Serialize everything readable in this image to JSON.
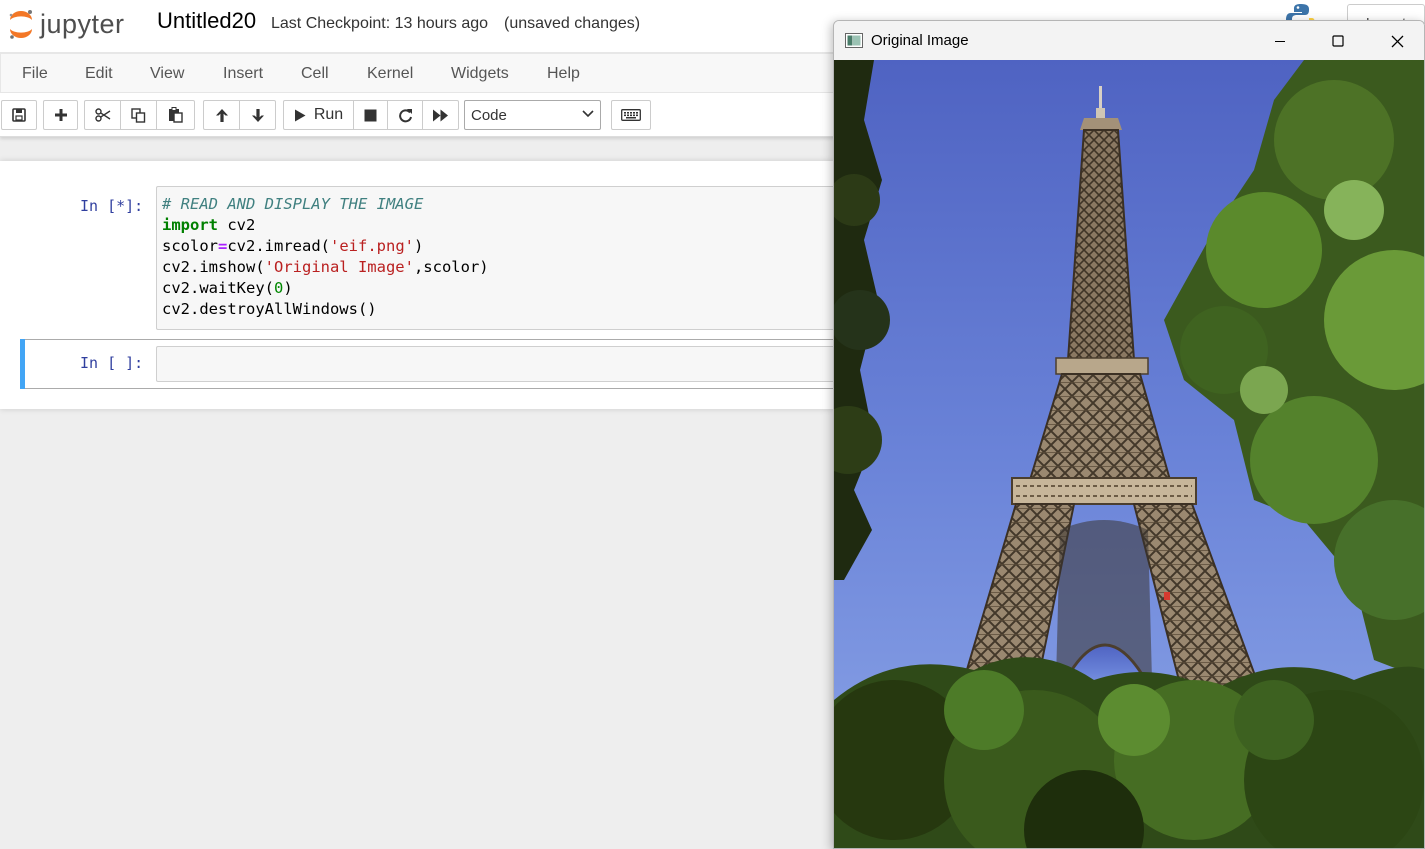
{
  "header": {
    "logo_text": "jupyter",
    "notebook_name": "Untitled20",
    "checkpoint": "Last Checkpoint: 13 hours ago",
    "autosave_status": "(unsaved changes)",
    "logout_label": "Logout"
  },
  "menu": {
    "items": [
      "File",
      "Edit",
      "View",
      "Insert",
      "Cell",
      "Kernel",
      "Widgets",
      "Help"
    ]
  },
  "toolbar": {
    "run_label": "Run",
    "cell_type": "Code"
  },
  "cells": [
    {
      "prompt": "In [*]:",
      "code": [
        "# READ AND DISPLAY THE IMAGE",
        "import cv2",
        "scolor=cv2.imread('eif.png')",
        "cv2.imshow('Original Image',scolor)",
        "cv2.waitKey(0)",
        "cv2.destroyAllWindows()"
      ]
    },
    {
      "prompt": "In [ ]:",
      "code": []
    }
  ],
  "image_window": {
    "title": "Original Image",
    "controls": [
      "minimize-icon",
      "maximize-icon",
      "close-icon"
    ],
    "content": "photo of the Eiffel Tower against blue sky framed by trees"
  },
  "colors": {
    "jupyter_orange": "#f37726",
    "selected_cell": "#42a5f5",
    "prompt_blue": "#303f9f",
    "sky": "#6a83d8",
    "tower": "#7d6b55",
    "foliage": "#2c3a16"
  }
}
